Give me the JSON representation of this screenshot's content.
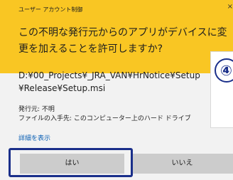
{
  "dialog": {
    "title": "ユーザー アカウント制御",
    "question": "この不明な発行元からのアプリがデバイスに変更を加えることを許可しますか?",
    "file_path": "D:¥00_Projects¥_JRA_VAN¥HrNotice¥Setup¥Release¥Setup.msi",
    "publisher": "発行元: 不明",
    "origin": "ファイルの入手先: このコンピューター上のハード ドライブ",
    "details_link": "詳細を表示",
    "yes_label": "はい",
    "no_label": "いいえ",
    "close_glyph": "×"
  },
  "annotation": {
    "step_number": "④"
  },
  "colors": {
    "header_bg": "#f9c623",
    "body_bg": "#f2f2f2",
    "button_bg": "#cccccc",
    "highlight": "#1a2f8a",
    "link": "#0a5fb4"
  }
}
